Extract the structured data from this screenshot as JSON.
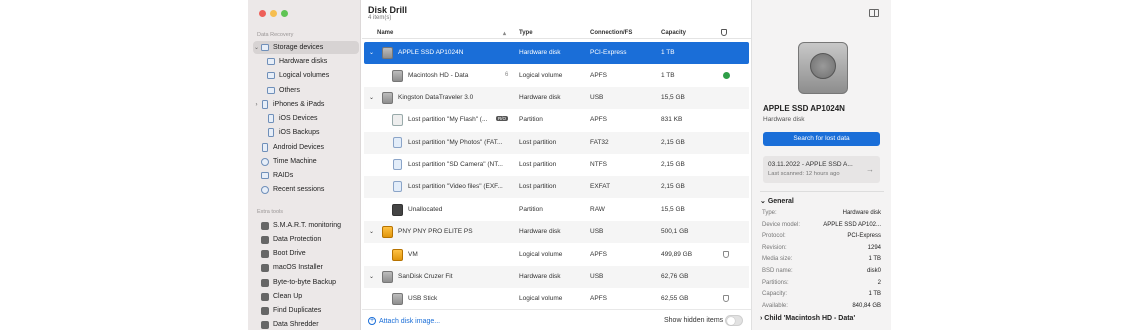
{
  "app": {
    "title": "Disk Drill",
    "subtitle": "4 item(s)"
  },
  "sidebar": {
    "data_recovery_header": "Data Recovery",
    "extra_tools_header": "Extra tools",
    "items": [
      {
        "label": "Storage devices",
        "icon": "drive-icon"
      },
      {
        "label": "Hardware disks",
        "icon": "drive-icon"
      },
      {
        "label": "Logical volumes",
        "icon": "drive-icon"
      },
      {
        "label": "Others",
        "icon": "drive-icon"
      },
      {
        "label": "iPhones & iPads",
        "icon": "phone-icon"
      },
      {
        "label": "iOS Devices",
        "icon": "phone-icon"
      },
      {
        "label": "iOS Backups",
        "icon": "phone-icon"
      },
      {
        "label": "Android Devices",
        "icon": "phone-icon"
      },
      {
        "label": "Time Machine",
        "icon": "clock-icon"
      },
      {
        "label": "RAIDs",
        "icon": "raid-icon"
      },
      {
        "label": "Recent sessions",
        "icon": "gear-icon"
      }
    ],
    "tools": [
      {
        "label": "S.M.A.R.T. monitoring",
        "icon": "smart-icon"
      },
      {
        "label": "Data Protection",
        "icon": "shield-icon"
      },
      {
        "label": "Boot Drive",
        "icon": "boot-drive-icon"
      },
      {
        "label": "macOS Installer",
        "icon": "installer-icon"
      },
      {
        "label": "Byte-to-byte Backup",
        "icon": "backup-icon"
      },
      {
        "label": "Clean Up",
        "icon": "cleanup-icon"
      },
      {
        "label": "Find Duplicates",
        "icon": "duplicates-icon"
      },
      {
        "label": "Data Shredder",
        "icon": "shredder-icon"
      }
    ]
  },
  "table": {
    "headers": {
      "name": "Name",
      "type": "Type",
      "conn": "Connection/FS",
      "cap": "Capacity"
    },
    "rows": [
      {
        "name": "APPLE SSD AP1024N",
        "type": "Hardware disk",
        "conn": "PCI-Express",
        "cap": "1 TB"
      },
      {
        "name": "Macintosh HD - Data",
        "extra": "6",
        "type": "Logical volume",
        "conn": "APFS",
        "cap": "1 TB"
      },
      {
        "name": "Kingston DataTraveler 3.0",
        "type": "Hardware disk",
        "conn": "USB",
        "cap": "15,5 GB"
      },
      {
        "name": "Lost partition \"My Flash\" (...",
        "tag": "R/O",
        "type": "Partition",
        "conn": "APFS",
        "cap": "831 KB"
      },
      {
        "name": "Lost partition \"My Photos\" (FAT...",
        "type": "Lost partition",
        "conn": "FAT32",
        "cap": "2,15 GB"
      },
      {
        "name": "Lost partition \"SD Camera\" (NT...",
        "type": "Lost partition",
        "conn": "NTFS",
        "cap": "2,15 GB"
      },
      {
        "name": "Lost partition \"Video files\" (EXF...",
        "type": "Lost partition",
        "conn": "EXFAT",
        "cap": "2,15 GB"
      },
      {
        "name": "Unallocated",
        "type": "Partition",
        "conn": "RAW",
        "cap": "15,5 GB"
      },
      {
        "name": "PNY PNY PRO ELITE PS",
        "type": "Hardware disk",
        "conn": "USB",
        "cap": "500,1 GB"
      },
      {
        "name": "VM",
        "type": "Logical volume",
        "conn": "APFS",
        "cap": "499,89 GB"
      },
      {
        "name": "SanDisk Cruzer Fit",
        "type": "Hardware disk",
        "conn": "USB",
        "cap": "62,76 GB"
      },
      {
        "name": "USB Stick",
        "type": "Logical volume",
        "conn": "APFS",
        "cap": "62,55 GB"
      }
    ]
  },
  "footer": {
    "attach": "Attach disk image...",
    "show_hidden": "Show hidden items"
  },
  "details": {
    "name": "APPLE SSD AP1024N",
    "type": "Hardware disk",
    "search_button": "Search for lost data",
    "session_title": "03.11.2022 - APPLE SSD A...",
    "session_sub": "Last scanned: 12 hours ago",
    "general_header": "General",
    "props": [
      {
        "k": "Type:",
        "v": "Hardware disk"
      },
      {
        "k": "Device model:",
        "v": "APPLE SSD AP102..."
      },
      {
        "k": "Protocol:",
        "v": "PCI-Express"
      },
      {
        "k": "Revision:",
        "v": "1294"
      },
      {
        "k": "Media size:",
        "v": "1 TB"
      },
      {
        "k": "BSD name:",
        "v": "disk0"
      },
      {
        "k": "Partitions:",
        "v": "2"
      },
      {
        "k": "Capacity:",
        "v": "1 TB"
      },
      {
        "k": "Available:",
        "v": "840,84 GB"
      }
    ],
    "child_header": "Child 'Macintosh HD - Data'"
  }
}
